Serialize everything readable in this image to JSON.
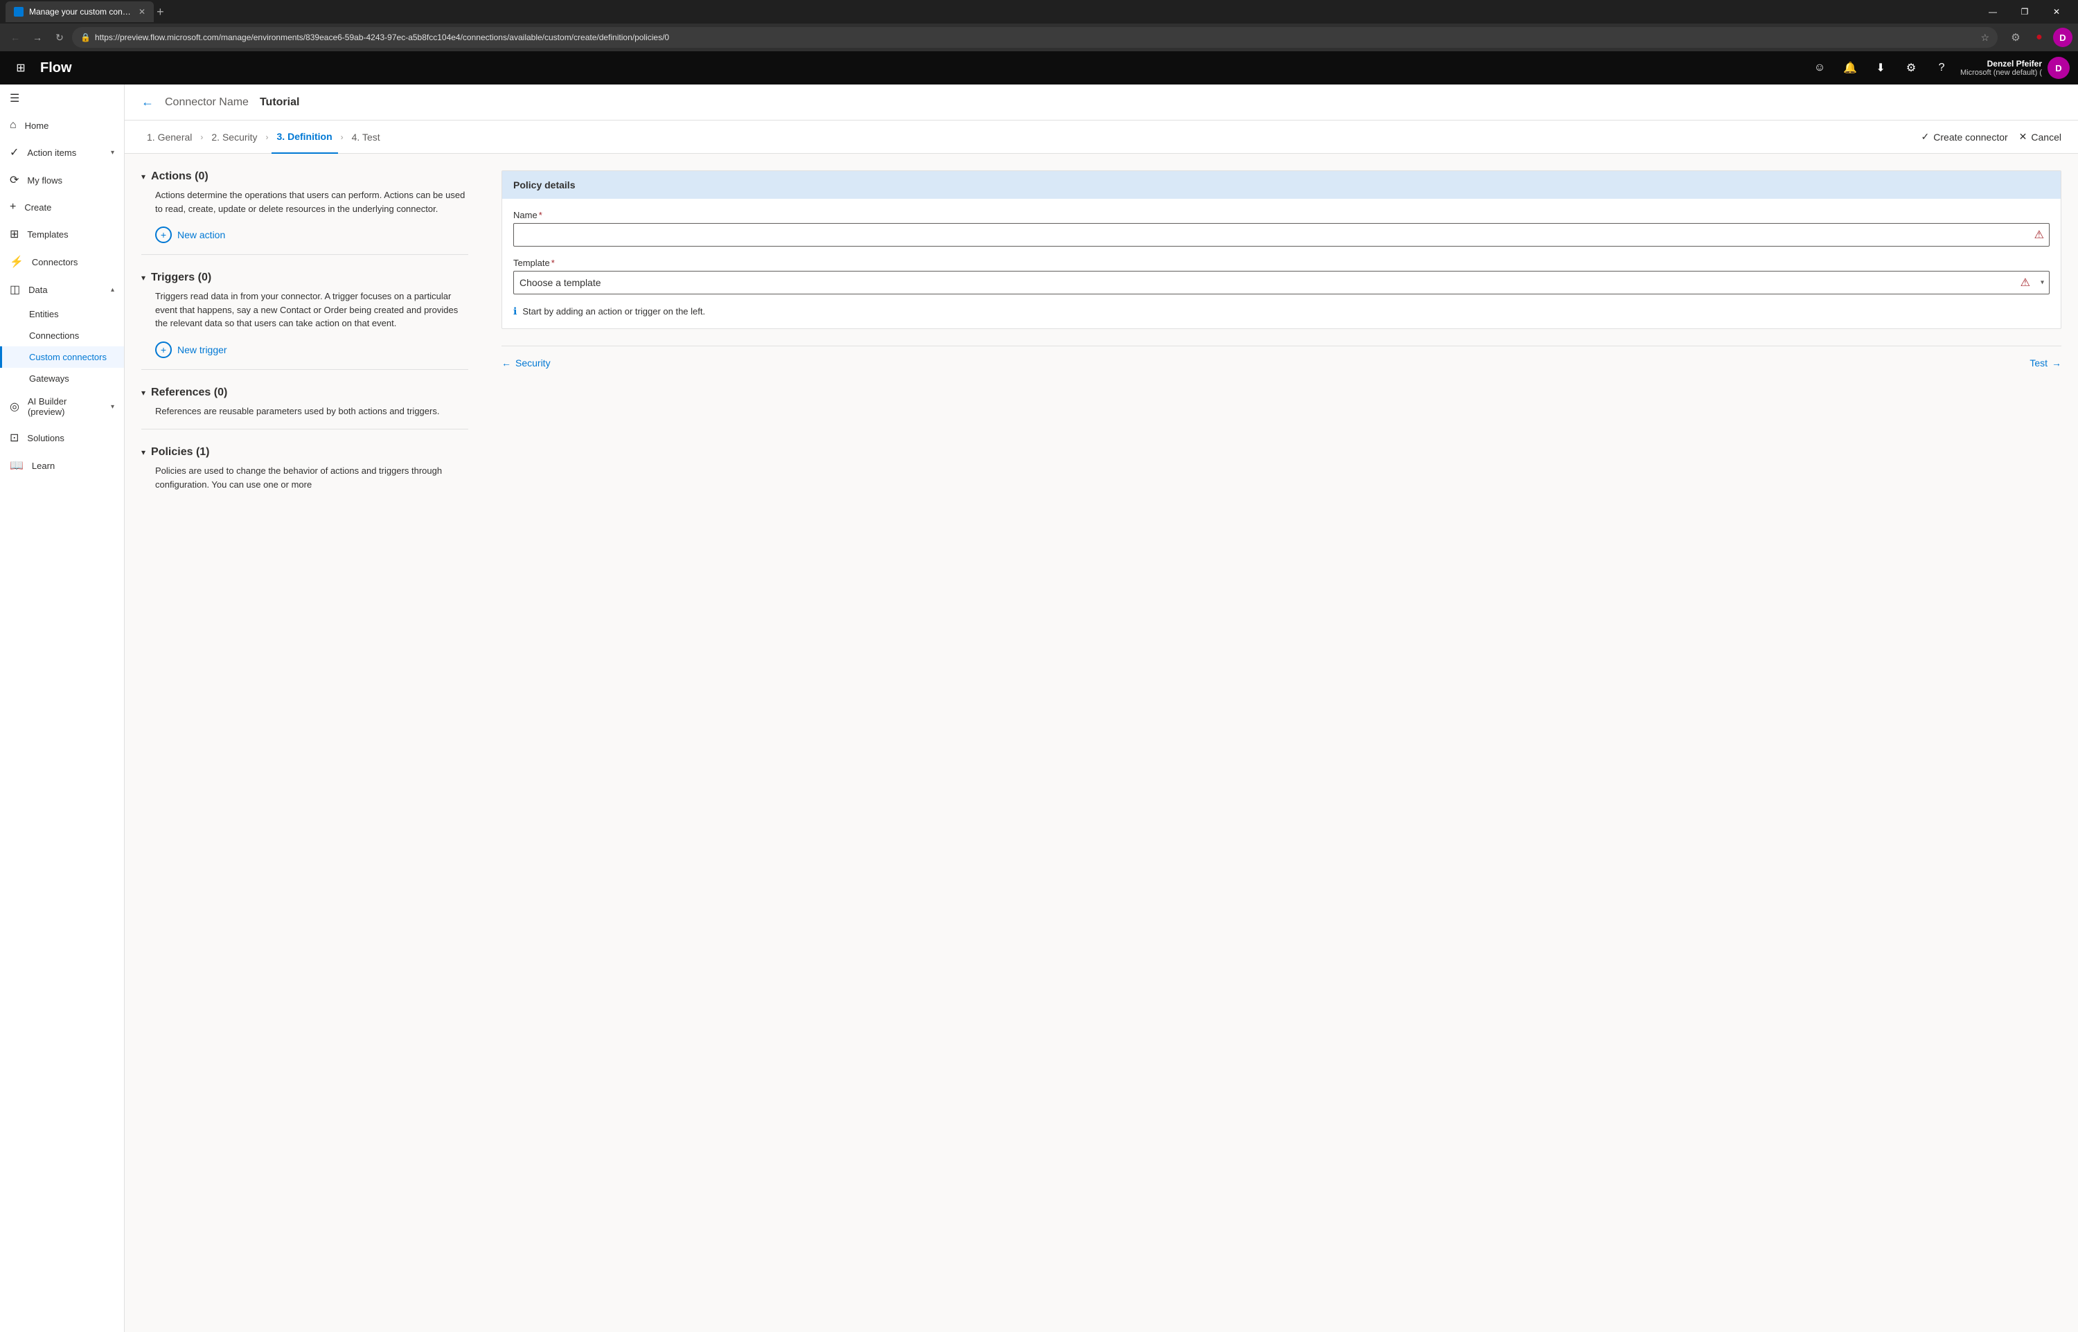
{
  "browser": {
    "tab": {
      "title": "Manage your custom connectors",
      "favicon": "M"
    },
    "url": "https://preview.flow.microsoft.com/manage/environments/839eace6-59ab-4243-97ec-a5b8fcc104e4/connections/available/custom/create/definition/policies/0",
    "controls": {
      "minimize": "—",
      "maximize": "❐",
      "close": "✕"
    }
  },
  "topbar": {
    "app_name": "Flow",
    "user_name": "Denzel Pfeifer",
    "user_org": "Microsoft (new default) (",
    "user_initials": "D"
  },
  "sidebar": {
    "items": [
      {
        "id": "hamburger",
        "label": "",
        "icon": "☰"
      },
      {
        "id": "home",
        "label": "Home",
        "icon": "⌂"
      },
      {
        "id": "action-items",
        "label": "Action items",
        "icon": "✓",
        "has_chevron": true
      },
      {
        "id": "my-flows",
        "label": "My flows",
        "icon": "⟳"
      },
      {
        "id": "create",
        "label": "Create",
        "icon": "+"
      },
      {
        "id": "templates",
        "label": "Templates",
        "icon": "⊞"
      },
      {
        "id": "connectors",
        "label": "Connectors",
        "icon": "⚡"
      },
      {
        "id": "data",
        "label": "Data",
        "icon": "◫",
        "has_chevron": true,
        "expanded": true
      },
      {
        "id": "entities",
        "label": "Entities",
        "sub": true
      },
      {
        "id": "connections",
        "label": "Connections",
        "sub": true
      },
      {
        "id": "custom-connectors",
        "label": "Custom connectors",
        "sub": true,
        "active": true
      },
      {
        "id": "gateways",
        "label": "Gateways",
        "sub": true
      },
      {
        "id": "ai-builder",
        "label": "AI Builder (preview)",
        "icon": "◎",
        "has_chevron": true
      },
      {
        "id": "solutions",
        "label": "Solutions",
        "icon": "⊡"
      },
      {
        "id": "learn",
        "label": "Learn",
        "icon": "📖"
      }
    ]
  },
  "page_header": {
    "back_icon": "←",
    "connector_name": "Connector Name",
    "connector_tutorial": "Tutorial"
  },
  "wizard": {
    "steps": [
      {
        "id": "general",
        "label": "1. General",
        "active": false
      },
      {
        "id": "security",
        "label": "2. Security",
        "active": false
      },
      {
        "id": "definition",
        "label": "3. Definition",
        "active": true
      },
      {
        "id": "test",
        "label": "4. Test",
        "active": false
      }
    ],
    "create_connector_label": "Create connector",
    "cancel_label": "Cancel"
  },
  "left_panel": {
    "sections": [
      {
        "id": "actions",
        "title": "Actions (0)",
        "description": "Actions determine the operations that users can perform. Actions can be used to read, create, update or delete resources in the underlying connector.",
        "new_button_label": "New action"
      },
      {
        "id": "triggers",
        "title": "Triggers (0)",
        "description": "Triggers read data in from your connector. A trigger focuses on a particular event that happens, say a new Contact or Order being created and provides the relevant data so that users can take action on that event.",
        "new_button_label": "New trigger"
      },
      {
        "id": "references",
        "title": "References (0)",
        "description": "References are reusable parameters used by both actions and triggers."
      },
      {
        "id": "policies",
        "title": "Policies (1)",
        "description": "Policies are used to change the behavior of actions and triggers through configuration. You can use one or more"
      }
    ]
  },
  "right_panel": {
    "policy_details": {
      "header": "Policy details",
      "name_label": "Name",
      "name_required": "*",
      "name_value": "",
      "template_label": "Template",
      "template_required": "*",
      "template_placeholder": "Choose a template",
      "template_options": [
        "Choose a template"
      ],
      "info_message": "Start by adding an action or trigger on the left."
    },
    "footer": {
      "back_label": "Security",
      "back_icon": "←",
      "forward_label": "Test",
      "forward_icon": "→"
    }
  }
}
